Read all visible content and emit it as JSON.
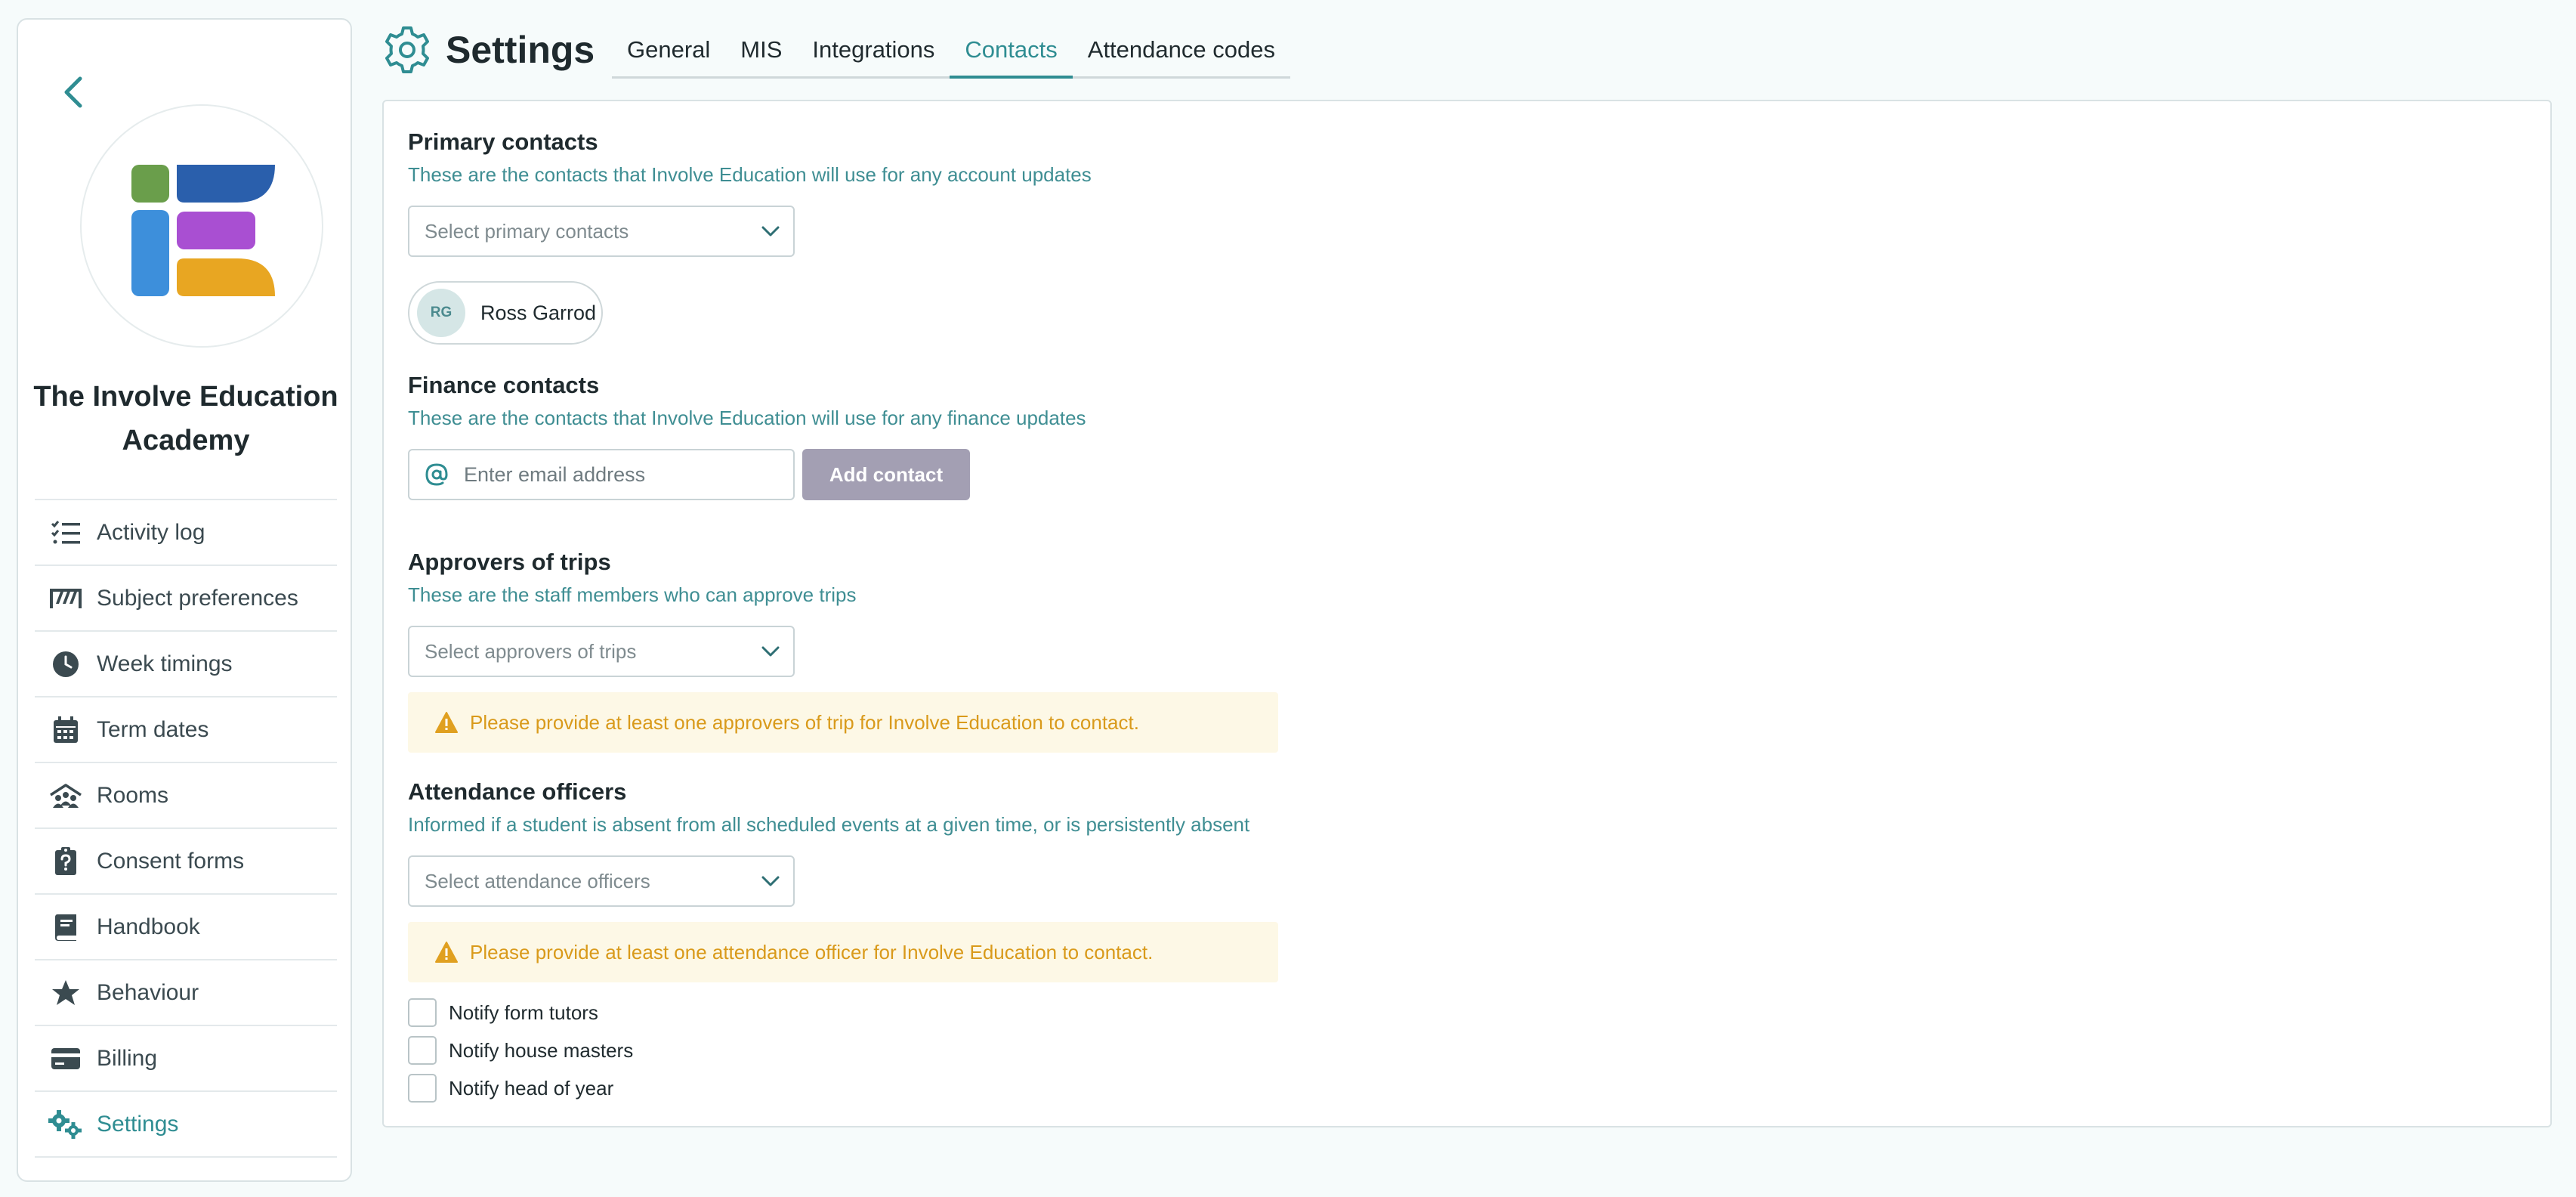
{
  "sidebar": {
    "school_name": "The Involve Education Academy",
    "items": [
      {
        "label": "Activity log",
        "icon": "checklist-icon"
      },
      {
        "label": "Subject preferences",
        "icon": "preferences-icon"
      },
      {
        "label": "Week timings",
        "icon": "clock-icon"
      },
      {
        "label": "Term dates",
        "icon": "calendar-icon"
      },
      {
        "label": "Rooms",
        "icon": "rooms-icon"
      },
      {
        "label": "Consent forms",
        "icon": "clipboard-question-icon"
      },
      {
        "label": "Handbook",
        "icon": "book-icon"
      },
      {
        "label": "Behaviour",
        "icon": "star-icon"
      },
      {
        "label": "Billing",
        "icon": "credit-card-icon"
      },
      {
        "label": "Settings",
        "icon": "gears-icon",
        "active": true
      }
    ]
  },
  "header": {
    "title": "Settings",
    "tabs": [
      {
        "label": "General"
      },
      {
        "label": "MIS"
      },
      {
        "label": "Integrations"
      },
      {
        "label": "Contacts",
        "active": true
      },
      {
        "label": "Attendance codes"
      }
    ]
  },
  "contacts": {
    "primary": {
      "title": "Primary contacts",
      "subtitle": "These are the contacts that Involve Education will use for any account updates",
      "select_placeholder": "Select primary contacts",
      "chip": {
        "initials": "RG",
        "name": "Ross Garrod"
      }
    },
    "finance": {
      "title": "Finance contacts",
      "subtitle": "These are the contacts that Involve Education will use for any finance updates",
      "email_placeholder": "Enter email address",
      "add_label": "Add contact"
    },
    "approvers": {
      "title": "Approvers of trips",
      "subtitle": "These are the staff members who can approve trips",
      "select_placeholder": "Select approvers of trips",
      "warning": "Please provide at least one approvers of trip for Involve Education to contact."
    },
    "attendance": {
      "title": "Attendance officers",
      "subtitle": "Informed if a student is absent from all scheduled events at a given time, or is persistently absent",
      "select_placeholder": "Select attendance officers",
      "warning": "Please provide at least one attendance officer for Involve Education to contact.",
      "checkboxes": [
        {
          "label": "Notify form tutors",
          "checked": false
        },
        {
          "label": "Notify house masters",
          "checked": false
        },
        {
          "label": "Notify head of year",
          "checked": false
        }
      ]
    }
  },
  "colors": {
    "accent": "#2f8d92",
    "warning_bg": "#fdf8e6",
    "warning_text": "#d99a1b",
    "button_disabled": "#a39fb3"
  }
}
